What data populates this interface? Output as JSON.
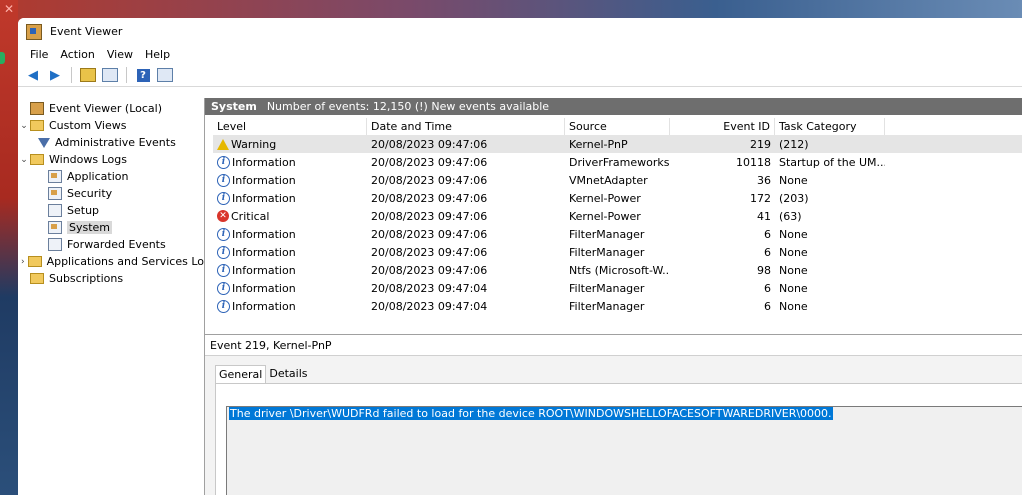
{
  "window": {
    "title": "Event Viewer"
  },
  "menu": [
    "File",
    "Action",
    "View",
    "Help"
  ],
  "toolbar_icons": [
    "back-arrow-icon",
    "forward-arrow-icon",
    "open-log-icon",
    "properties-icon",
    "help-icon",
    "show-pane-icon"
  ],
  "tree": {
    "root": "Event Viewer (Local)",
    "custom_views": "Custom Views",
    "administrative_events": "Administrative Events",
    "windows_logs": "Windows Logs",
    "application": "Application",
    "security": "Security",
    "setup": "Setup",
    "system": "System",
    "forwarded_events": "Forwarded Events",
    "apps_services": "Applications and Services Lo",
    "subscriptions": "Subscriptions"
  },
  "header": {
    "title": "System",
    "subtitle": "Number of events: 12,150 (!) New events available"
  },
  "columns": [
    "Level",
    "Date and Time",
    "Source",
    "Event ID",
    "Task Category"
  ],
  "events": [
    {
      "level": "Warning",
      "icon": "warning",
      "date": "20/08/2023 09:47:06",
      "source": "Kernel-PnP",
      "id": "219",
      "category": "(212)"
    },
    {
      "level": "Information",
      "icon": "info",
      "date": "20/08/2023 09:47:06",
      "source": "DriverFrameworks...",
      "id": "10118",
      "category": "Startup of the UM..."
    },
    {
      "level": "Information",
      "icon": "info",
      "date": "20/08/2023 09:47:06",
      "source": "VMnetAdapter",
      "id": "36",
      "category": "None"
    },
    {
      "level": "Information",
      "icon": "info",
      "date": "20/08/2023 09:47:06",
      "source": "Kernel-Power",
      "id": "172",
      "category": "(203)"
    },
    {
      "level": "Critical",
      "icon": "critical",
      "date": "20/08/2023 09:47:06",
      "source": "Kernel-Power",
      "id": "41",
      "category": "(63)"
    },
    {
      "level": "Information",
      "icon": "info",
      "date": "20/08/2023 09:47:06",
      "source": "FilterManager",
      "id": "6",
      "category": "None"
    },
    {
      "level": "Information",
      "icon": "info",
      "date": "20/08/2023 09:47:06",
      "source": "FilterManager",
      "id": "6",
      "category": "None"
    },
    {
      "level": "Information",
      "icon": "info",
      "date": "20/08/2023 09:47:06",
      "source": "Ntfs (Microsoft-W...",
      "id": "98",
      "category": "None"
    },
    {
      "level": "Information",
      "icon": "info",
      "date": "20/08/2023 09:47:04",
      "source": "FilterManager",
      "id": "6",
      "category": "None"
    },
    {
      "level": "Information",
      "icon": "info",
      "date": "20/08/2023 09:47:04",
      "source": "FilterManager",
      "id": "6",
      "category": "None"
    }
  ],
  "detail": {
    "title": "Event 219, Kernel-PnP",
    "tab_general": "General",
    "tab_details": "Details",
    "description": "The driver \\Driver\\WUDFRd failed to load for the device ROOT\\WINDOWSHELLOFACESOFTWAREDRIVER\\0000."
  },
  "colors": {
    "header_bar": "#6e6e6e",
    "selection": "#0078d7",
    "critical": "#d9352b",
    "warning": "#e6b800",
    "info": "#2d63b7"
  }
}
